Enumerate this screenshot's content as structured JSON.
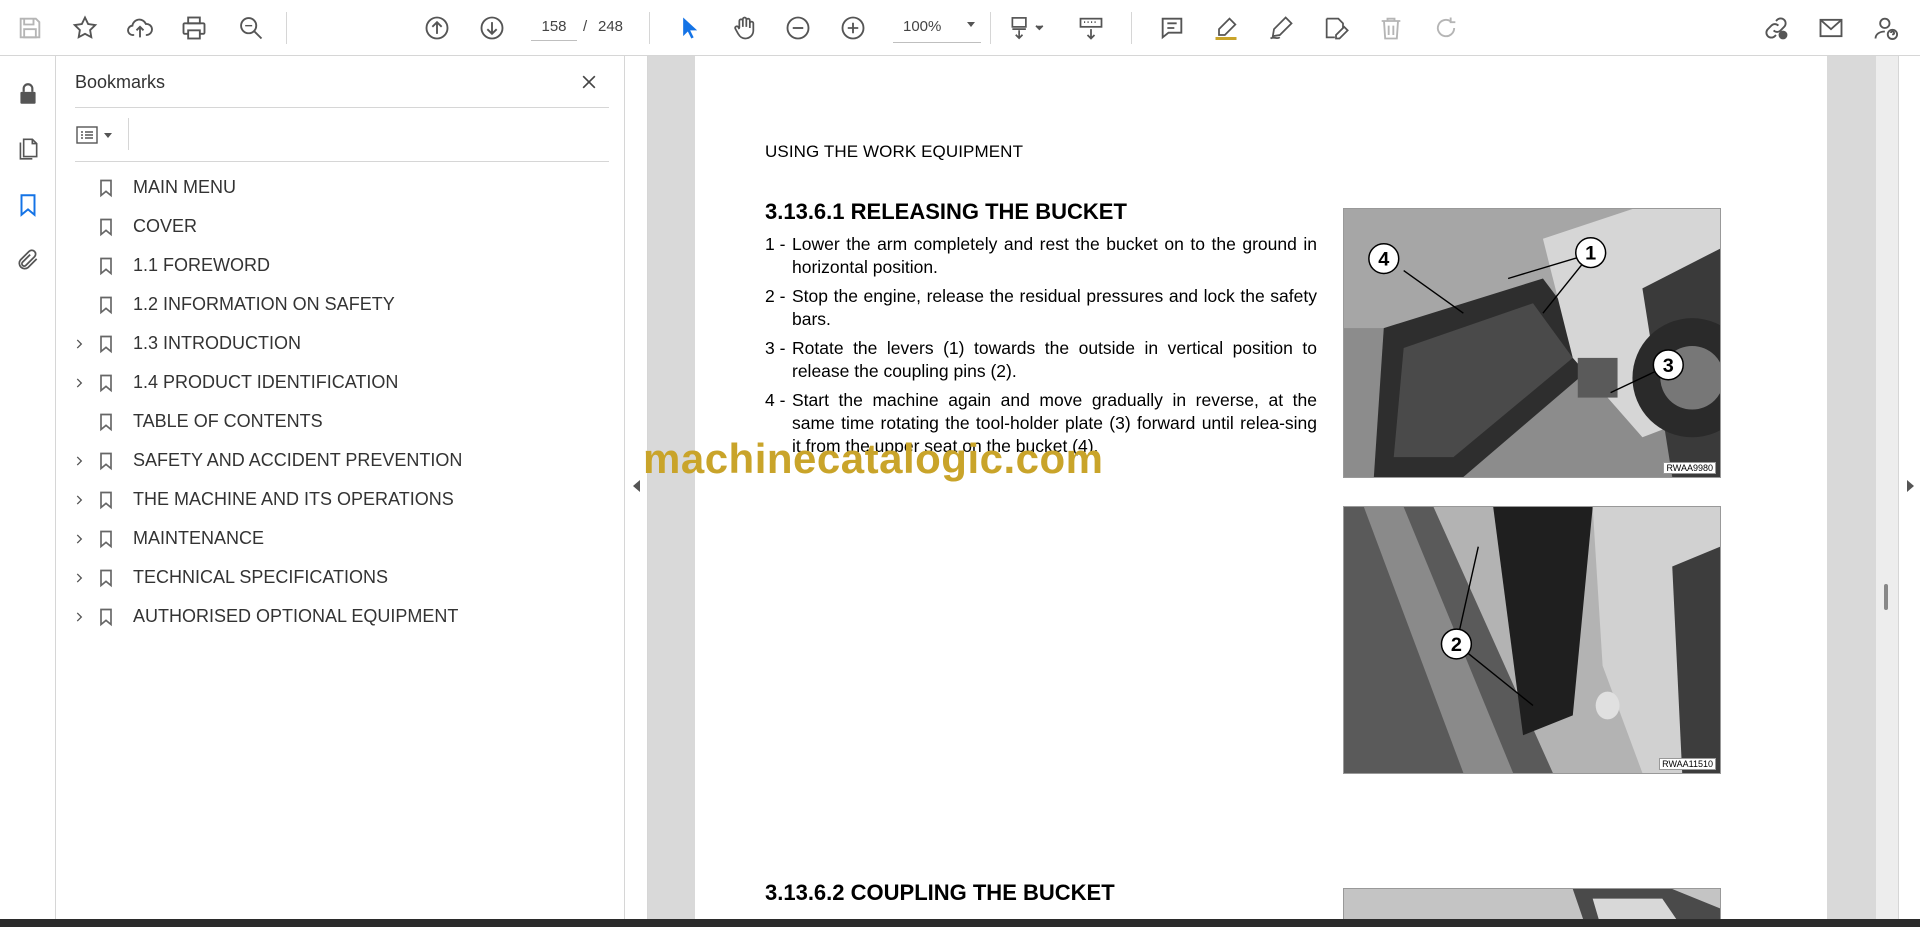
{
  "toolbar": {
    "page_current": "158",
    "page_separator": "/",
    "page_total": "248",
    "zoom": "100%",
    "icons": [
      "save-icon",
      "star-icon",
      "upload-icon",
      "print-icon",
      "find-icon",
      "previous-page-icon",
      "next-page-icon",
      "select-cursor-icon",
      "hand-icon",
      "zoom-out-icon",
      "zoom-in-icon",
      "page-fit-icon",
      "scroll-mode-icon",
      "comment-icon",
      "highlight-icon",
      "draw-icon",
      "fill-sign-icon",
      "delete-icon",
      "rotate-icon",
      "share-link-icon",
      "email-icon",
      "account-help-icon"
    ],
    "accent_color": "#1473e6"
  },
  "left_rail": {
    "items": [
      "lock-icon",
      "pages-icon",
      "bookmark-icon",
      "attachment-icon"
    ],
    "active": "bookmark-icon"
  },
  "bookmarks": {
    "title": "Bookmarks",
    "items": [
      {
        "label": "MAIN MENU",
        "expandable": false
      },
      {
        "label": "COVER",
        "expandable": false
      },
      {
        "label": "1.1 FOREWORD",
        "expandable": false
      },
      {
        "label": "1.2 INFORMATION ON SAFETY",
        "expandable": false
      },
      {
        "label": "1.3 INTRODUCTION",
        "expandable": true
      },
      {
        "label": "1.4 PRODUCT IDENTIFICATION",
        "expandable": true
      },
      {
        "label": "TABLE OF CONTENTS",
        "expandable": false
      },
      {
        "label": "SAFETY AND ACCIDENT PREVENTION",
        "expandable": true
      },
      {
        "label": "THE MACHINE AND ITS OPERATIONS",
        "expandable": true
      },
      {
        "label": "MAINTENANCE",
        "expandable": true
      },
      {
        "label": "TECHNICAL SPECIFICATIONS",
        "expandable": true
      },
      {
        "label": "AUTHORISED OPTIONAL EQUIPMENT",
        "expandable": true
      }
    ]
  },
  "document": {
    "header": "USING THE WORK EQUIPMENT",
    "section1": {
      "number": "3.13.6.1",
      "title": "RELEASING THE BUCKET",
      "steps": [
        {
          "num": "1 -",
          "text": "Lower the arm completely and rest the bucket on to the ground in horizontal position."
        },
        {
          "num": "2 -",
          "text": "Stop the engine, release the residual pressures and lock the safety bars."
        },
        {
          "num": "3 -",
          "text": "Rotate the levers (1) towards the outside in vertical position to release the coupling pins (2)."
        },
        {
          "num": "4 -",
          "text": "Start the machine again and move gradually in reverse, at the same time rotating the tool-holder plate (3) forward until relea-sing it from the upper seat on the bucket (4)."
        }
      ]
    },
    "section2": {
      "number": "3.13.6.2",
      "title": "COUPLING THE BUCKET"
    },
    "photo1": {
      "code": "RWAA9980",
      "callouts": [
        "1",
        "3",
        "4"
      ]
    },
    "photo2": {
      "code": "RWAA11510",
      "callouts": [
        "2"
      ]
    },
    "watermark": "machinecatalogic.com",
    "watermark_color": "#c9a42a"
  }
}
